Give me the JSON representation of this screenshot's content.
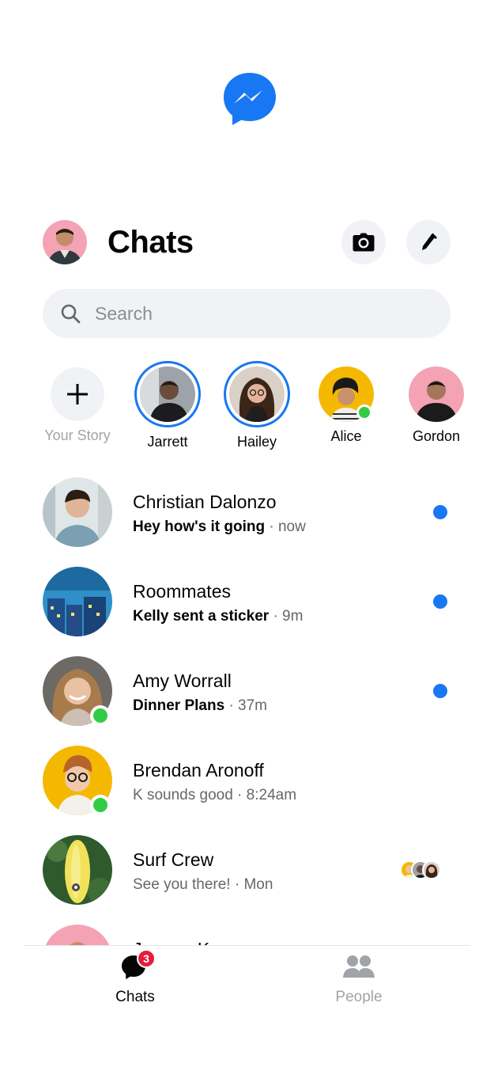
{
  "app": {
    "logo_icon": "messenger-logo-icon",
    "brand_color": "#1877f2"
  },
  "header": {
    "title": "Chats",
    "camera_icon": "camera-icon",
    "edit_icon": "pencil-icon"
  },
  "search": {
    "placeholder": "Search"
  },
  "stories": [
    {
      "name": "Your Story",
      "type": "add"
    },
    {
      "name": "Jarrett",
      "type": "story"
    },
    {
      "name": "Hailey",
      "type": "story"
    },
    {
      "name": "Alice",
      "type": "online"
    },
    {
      "name": "Gordon",
      "type": "plain"
    }
  ],
  "chats": [
    {
      "name": "Christian Dalonzo",
      "message": "Hey how's it going",
      "time": "· now",
      "unread": true,
      "online": false
    },
    {
      "name": "Roommates",
      "message": "Kelly sent a sticker",
      "time": "· 9m",
      "unread": true,
      "online": false
    },
    {
      "name": "Amy Worrall",
      "message": "Dinner Plans",
      "time": "· 37m",
      "unread": true,
      "online": true
    },
    {
      "name": "Brendan Aronoff",
      "message": "K sounds good",
      "time": "· 8:24am",
      "unread": false,
      "online": true
    },
    {
      "name": "Surf Crew",
      "message": "See you there!",
      "time": "· Mon",
      "unread": false,
      "online": false
    },
    {
      "name": "Jeremy Kamp",
      "message": "",
      "time": "",
      "unread": false,
      "online": false
    }
  ],
  "nav": {
    "chats_label": "Chats",
    "chats_badge": "3",
    "people_label": "People"
  },
  "colors": {
    "online": "#31cc46",
    "unread_dot": "#1877f2",
    "badge": "#e41e3f"
  }
}
